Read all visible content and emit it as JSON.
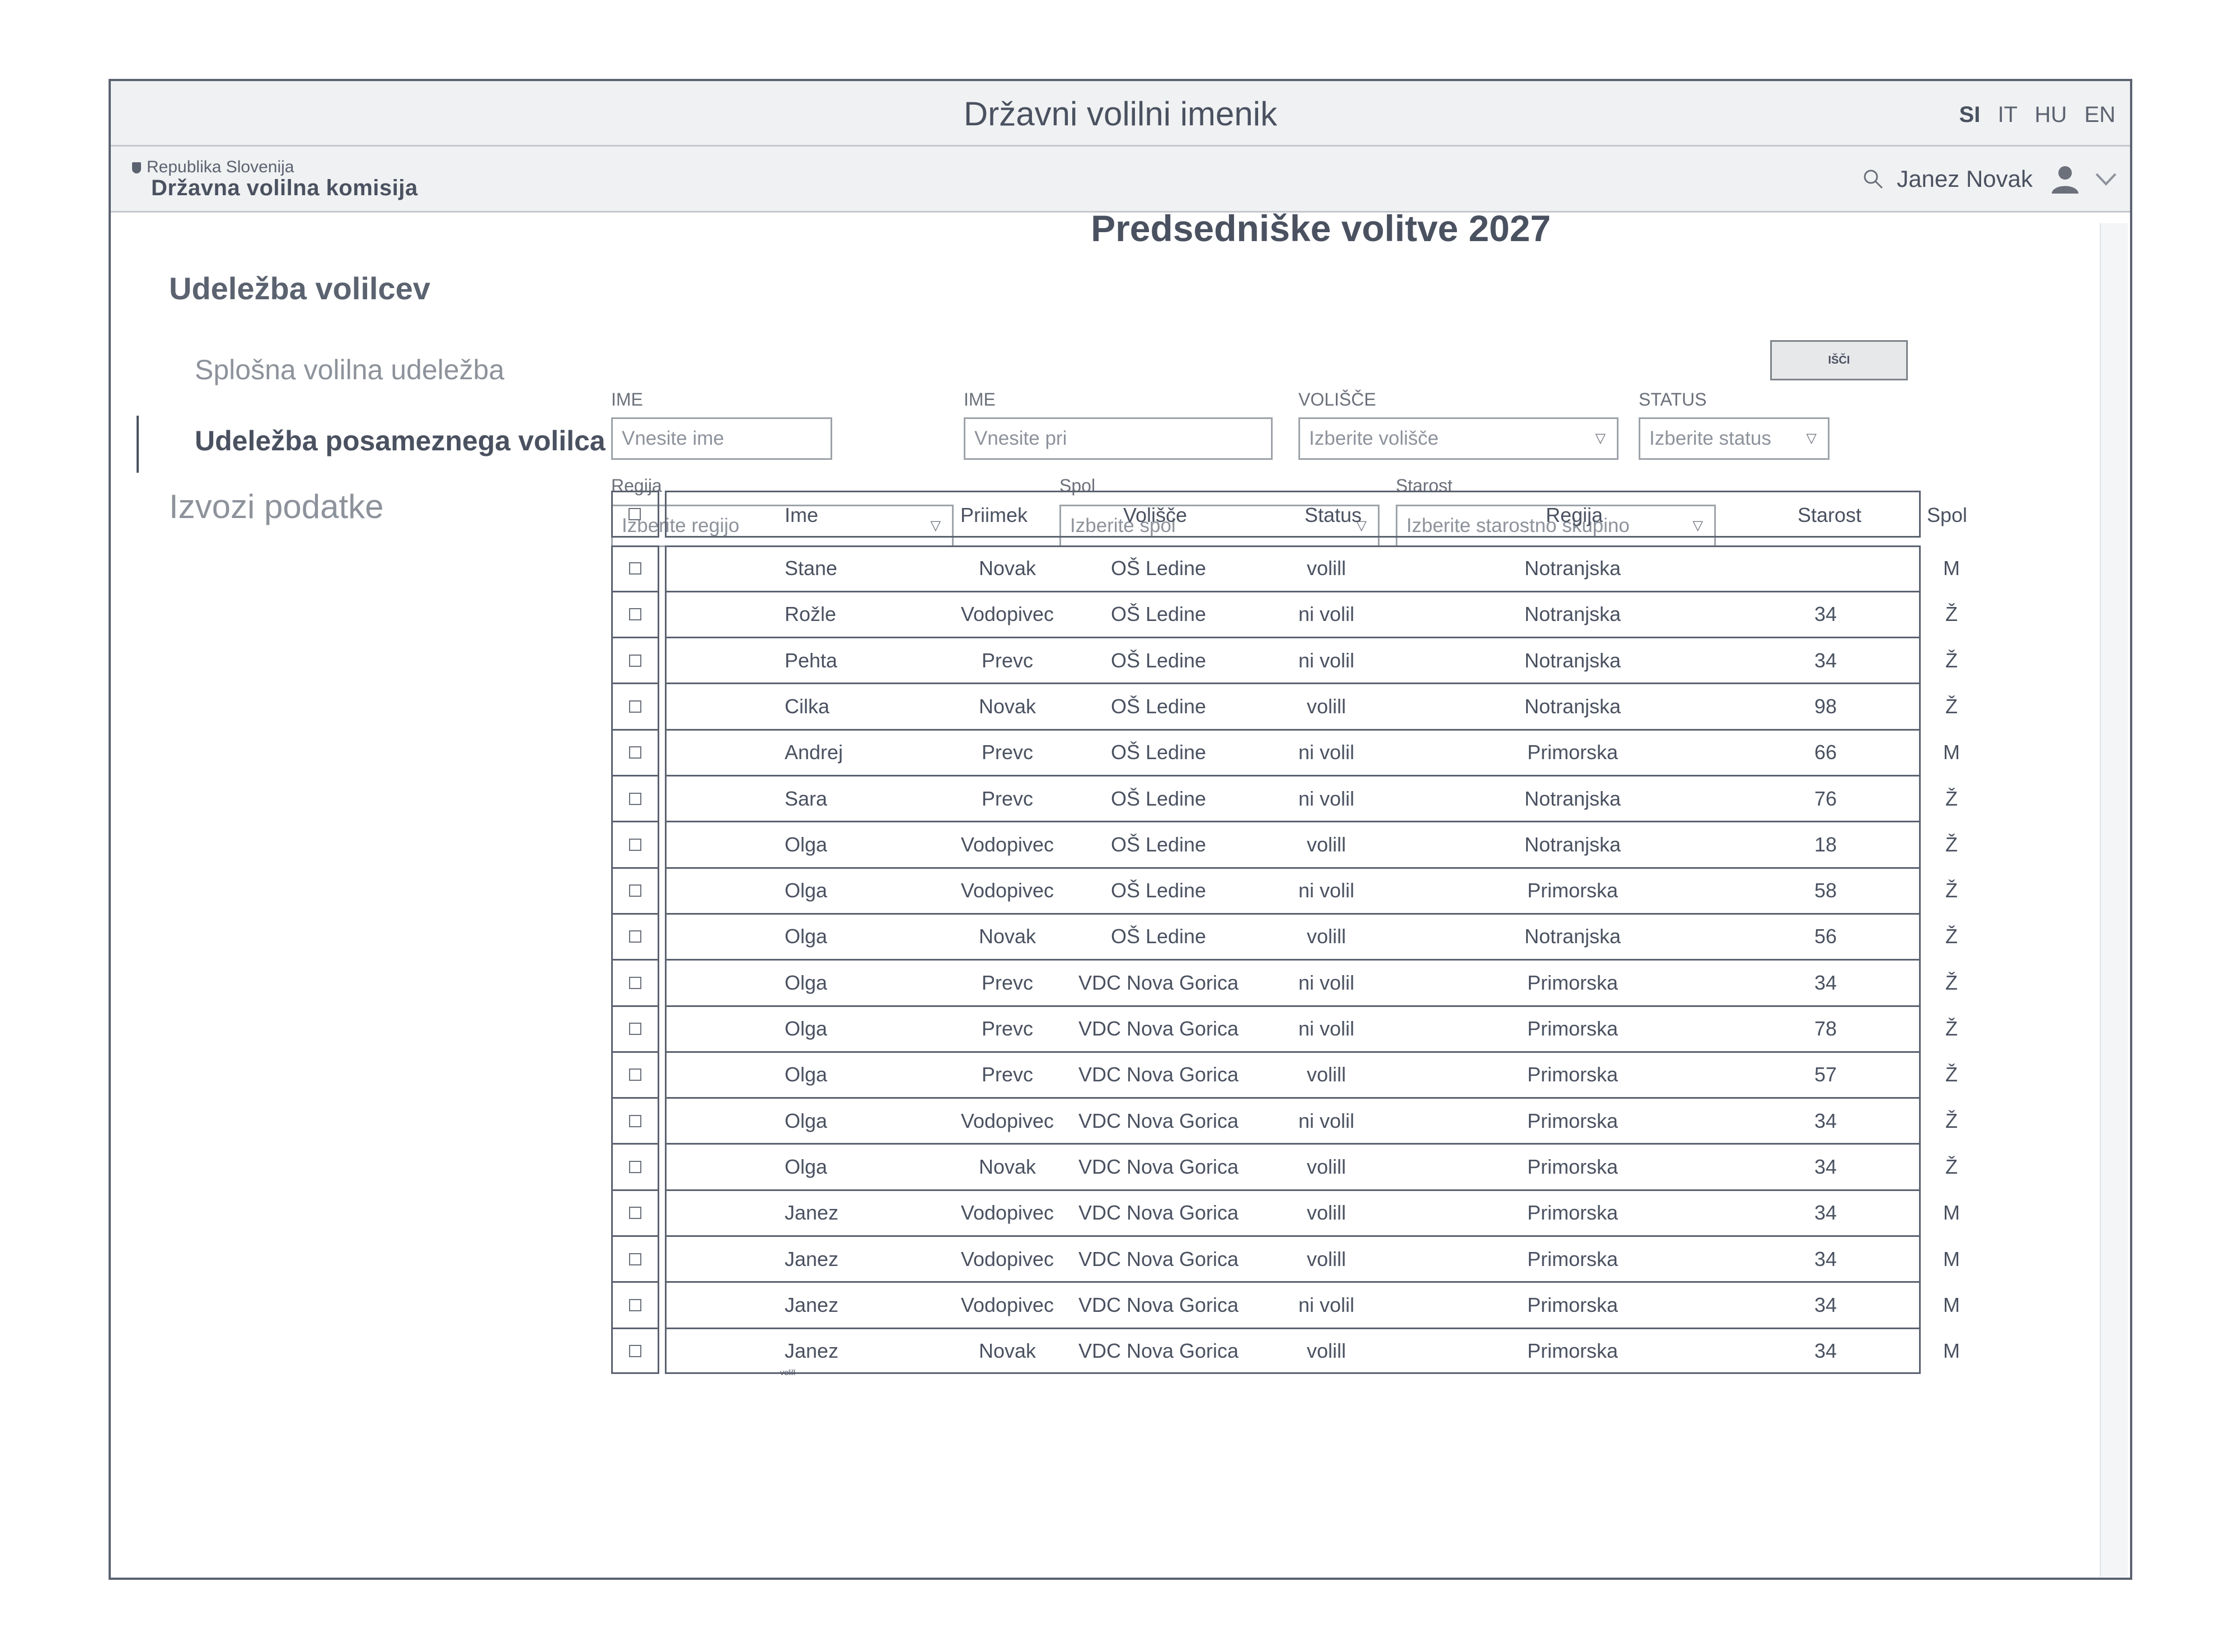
{
  "app": {
    "title": "Državni volilni imenik"
  },
  "languages": [
    "SI",
    "IT",
    "HU",
    "EN"
  ],
  "active_language": "SI",
  "org": {
    "country": "Republika Slovenija",
    "name": "Državna volilna komisija"
  },
  "user": {
    "name": "Janez Novak"
  },
  "sidebar": {
    "title": "Udeležba volilcev",
    "items": [
      {
        "label": "Splošna volilna udeležba"
      },
      {
        "label": "Udeležba posameznega volilca"
      },
      {
        "label": "Izvozi podatke"
      }
    ]
  },
  "page": {
    "title": "Predsedniške volitve 2027"
  },
  "filters": {
    "ime": {
      "label": "IME",
      "placeholder": "Vnesite ime"
    },
    "priimek": {
      "label": "IME",
      "placeholder": "Vnesite pri"
    },
    "volisce": {
      "label": "VOLIŠČE",
      "placeholder": "Izberite volišče"
    },
    "status": {
      "label": "STATUS",
      "placeholder": "Izberite status"
    },
    "search_button": "IŠČI",
    "regija": {
      "label": "Regija",
      "placeholder": "Izberite regijo"
    },
    "spol": {
      "label": "Spol",
      "placeholder": "Izberite spol"
    },
    "starost": {
      "label": "Starost",
      "placeholder": "Izberite starostno skupino"
    }
  },
  "table": {
    "headers": [
      "Ime",
      "Priimek",
      "Volišče",
      "Status",
      "Regija",
      "Starost",
      "Spol"
    ],
    "rows": [
      [
        "Stane",
        "Novak",
        "OŠ Ledine",
        "volill",
        "Notranjska",
        "",
        "M"
      ],
      [
        "Rožle",
        "Vodopivec",
        "OŠ Ledine",
        "ni volil",
        "Notranjska",
        "34",
        "Ž"
      ],
      [
        "Pehta",
        "Prevc",
        "OŠ Ledine",
        "ni volil",
        "Notranjska",
        "34",
        "Ž"
      ],
      [
        "Cilka",
        "Novak",
        "OŠ Ledine",
        "volill",
        "Notranjska",
        "98",
        "Ž"
      ],
      [
        "Andrej",
        "Prevc",
        "OŠ Ledine",
        "ni volil",
        "Primorska",
        "66",
        "M"
      ],
      [
        "Sara",
        "Prevc",
        "OŠ Ledine",
        "ni volil",
        "Notranjska",
        "76",
        "Ž"
      ],
      [
        "Olga",
        "Vodopivec",
        "OŠ Ledine",
        "volill",
        "Notranjska",
        "18",
        "Ž"
      ],
      [
        "Olga",
        "Vodopivec",
        "OŠ Ledine",
        "ni volil",
        "Primorska",
        "58",
        "Ž"
      ],
      [
        "Olga",
        "Novak",
        "OŠ Ledine",
        "volill",
        "Notranjska",
        "56",
        "Ž"
      ],
      [
        "Olga",
        "Prevc",
        "VDC Nova Gorica",
        "ni volil",
        "Primorska",
        "34",
        "Ž"
      ],
      [
        "Olga",
        "Prevc",
        "VDC Nova Gorica",
        "ni volil",
        "Primorska",
        "78",
        "Ž"
      ],
      [
        "Olga",
        "Prevc",
        "VDC Nova Gorica",
        "volill",
        "Primorska",
        "57",
        "Ž"
      ],
      [
        "Olga",
        "Vodopivec",
        "VDC Nova Gorica",
        "ni volil",
        "Primorska",
        "34",
        "Ž"
      ],
      [
        "Olga",
        "Novak",
        "VDC Nova Gorica",
        "volill",
        "Primorska",
        "34",
        "Ž"
      ],
      [
        "Janez",
        "Vodopivec",
        "VDC Nova Gorica",
        "volill",
        "Primorska",
        "34",
        "M"
      ],
      [
        "Janez",
        "Vodopivec",
        "VDC Nova Gorica",
        "volill",
        "Primorska",
        "34",
        "M"
      ],
      [
        "Janez",
        "Vodopivec",
        "VDC Nova Gorica",
        "ni volil",
        "Primorska",
        "34",
        "M"
      ],
      [
        "Janez",
        "Novak",
        "VDC Nova Gorica",
        "volill",
        "Primorska",
        "34",
        "M"
      ]
    ],
    "stray_note": "volill"
  }
}
